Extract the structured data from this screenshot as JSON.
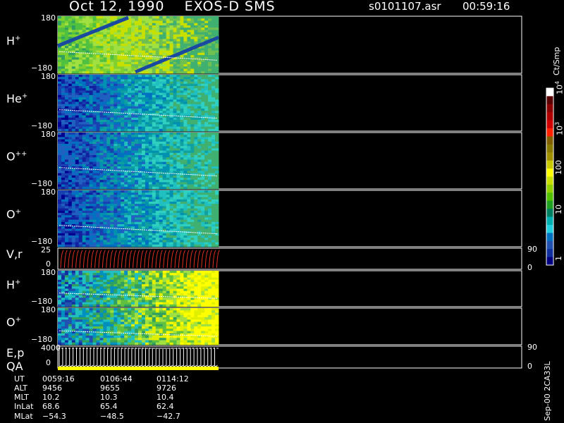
{
  "header": {
    "date": "Oct 12, 1990",
    "instrument": "EXOS-D SMS",
    "filename": "s0101107.asr",
    "time": "00:59:16"
  },
  "panels": [
    {
      "label": "H",
      "sup": "+",
      "ymax": "180",
      "ymin": "-180"
    },
    {
      "label": "He",
      "sup": "+",
      "ymax": "180",
      "ymin": "-180"
    },
    {
      "label": "O",
      "sup": "++",
      "ymax": "180",
      "ymin": "-180"
    },
    {
      "label": "O",
      "sup": "+",
      "ymax": "180",
      "ymin": "-180"
    },
    {
      "label": "V,r",
      "sup": "",
      "ymax": "25",
      "ymin": "0",
      "right_top": "90",
      "right_bottom": "0"
    },
    {
      "label": "H",
      "sup": "+",
      "ymax": "180",
      "ymin": "-180"
    },
    {
      "label": "O",
      "sup": "+",
      "ymax": "180",
      "ymin": "-180"
    },
    {
      "label": "E,p",
      "sup": "",
      "ymax": "4000",
      "ymin": "0",
      "right_top": "90",
      "right_bottom": "0"
    }
  ],
  "qa_label": "QA",
  "colorbar": {
    "title": "Ct/Smp",
    "labels": [
      {
        "base": "10",
        "exp": "4"
      },
      {
        "base": "10",
        "exp": "3"
      },
      {
        "base": "100",
        "exp": ""
      },
      {
        "base": "10",
        "exp": ""
      },
      {
        "base": "1",
        "exp": ""
      }
    ],
    "colors": [
      "#ffffff",
      "#5a0000",
      "#8b0000",
      "#b00000",
      "#d00000",
      "#ff2000",
      "#806000",
      "#8a7a00",
      "#a09000",
      "#c8c800",
      "#ffff00",
      "#c8e000",
      "#90d000",
      "#50c000",
      "#20a020",
      "#008060",
      "#00b0b0",
      "#20d0e0",
      "#0070c0",
      "#2050b0",
      "#1030a0",
      "#000080"
    ]
  },
  "footer_note": "Sep-00 2CA33L",
  "ephemeris": {
    "row_labels": [
      "UT",
      "ALT",
      "MLT",
      "InLat",
      "MLat"
    ],
    "columns": [
      [
        "0059:16",
        "9456",
        "10.2",
        "68.6",
        "-54.3"
      ],
      [
        "0106:44",
        "9655",
        "10.3",
        "65.4",
        "-48.5"
      ],
      [
        "0114:12",
        "9726",
        "10.4",
        "62.4",
        "-42.7"
      ]
    ]
  },
  "chart_data": {
    "type": "heatmap",
    "title": "Oct 12, 1990   EXOS-D SMS",
    "x": [
      "0059:16",
      "0106:44",
      "0114:12"
    ],
    "panels": [
      "H+",
      "He+",
      "O++",
      "O+",
      "V,r",
      "H+",
      "O+",
      "E,p"
    ],
    "ylim_angle": [
      -180,
      180
    ],
    "ylim_velocity": [
      0,
      25
    ],
    "ylim_energy": [
      0,
      4000
    ],
    "colorbar_range": [
      "1",
      "10^4"
    ],
    "colorbar_unit": "Ct/Smp"
  }
}
